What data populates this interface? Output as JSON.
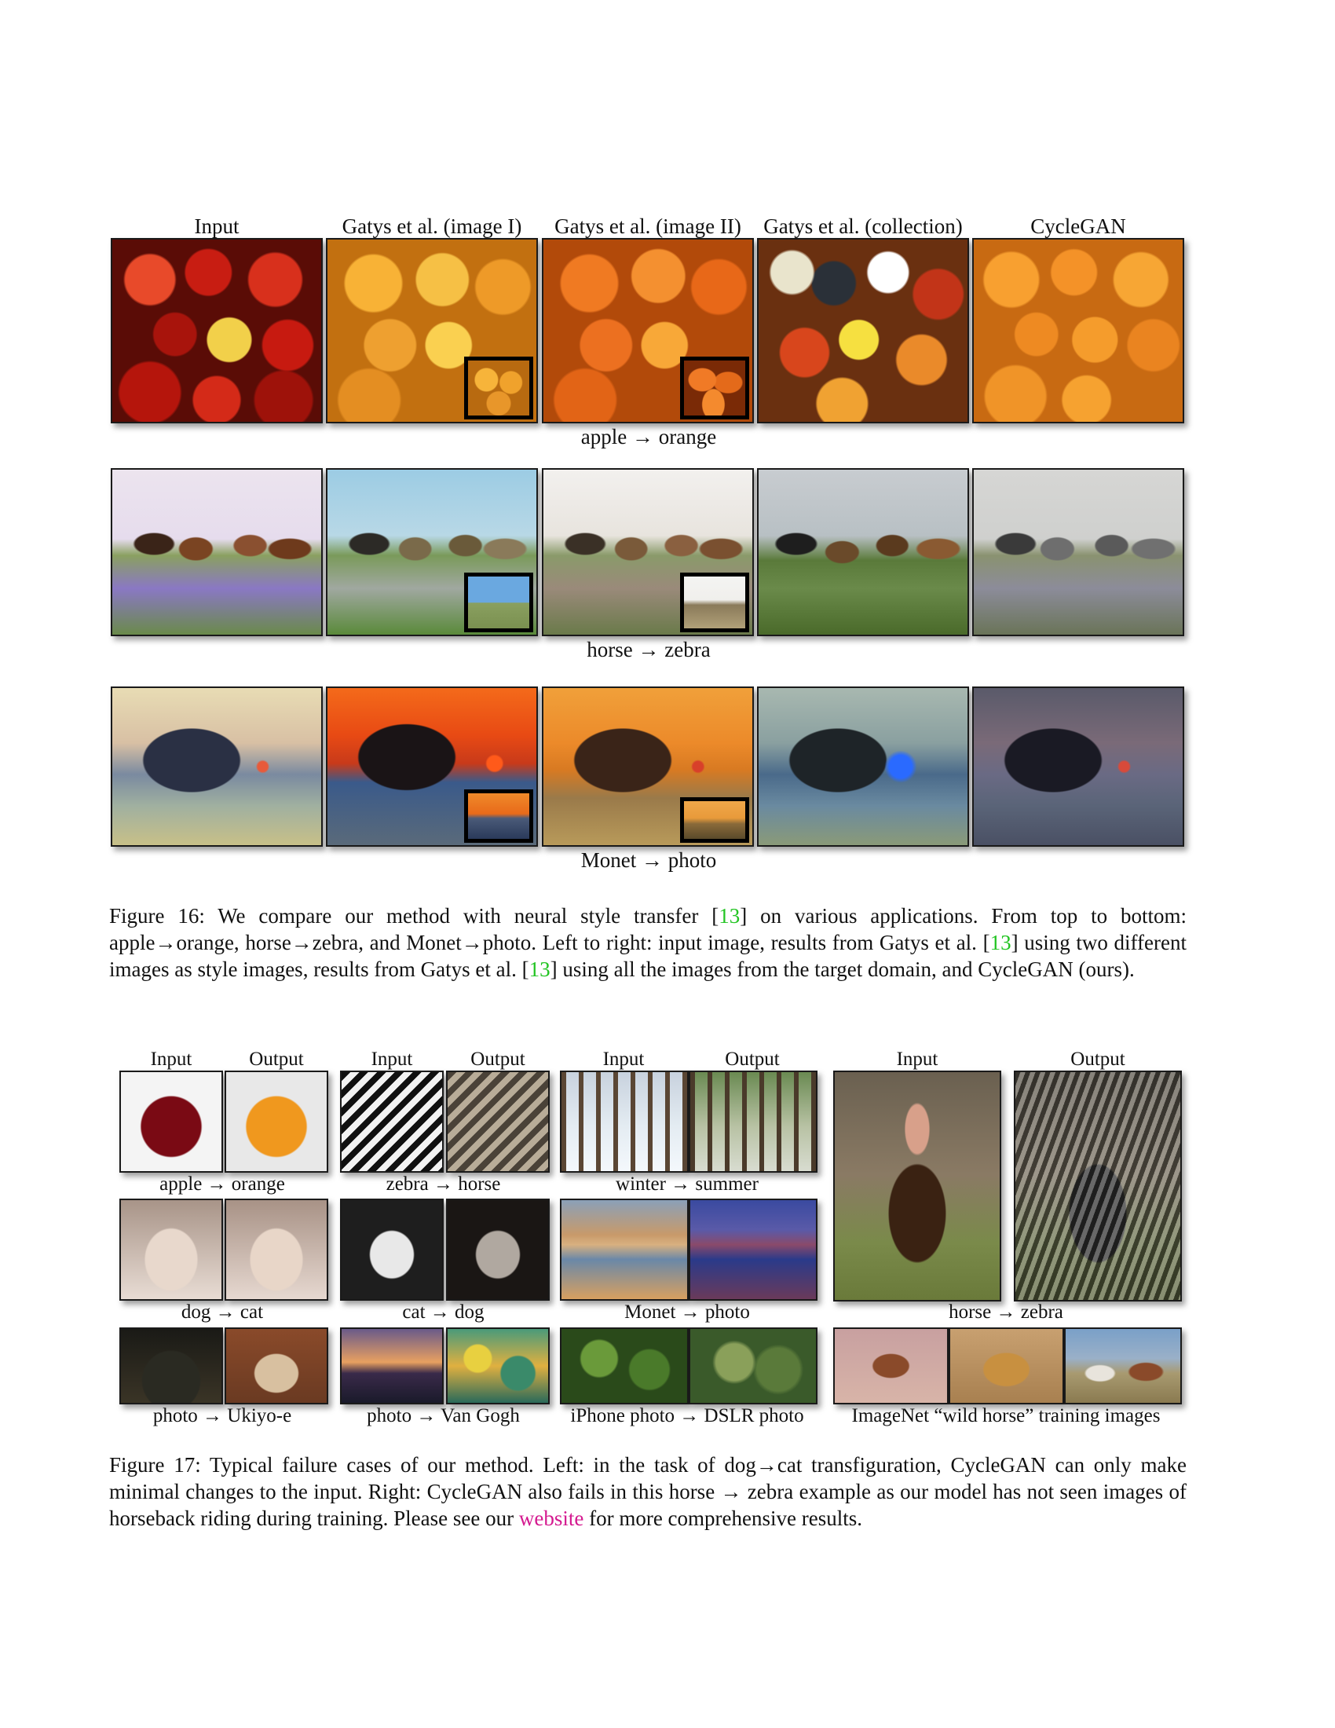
{
  "figure16": {
    "column_headers": [
      "Input",
      "Gatys et al. (image I)",
      "Gatys et al. (image II)",
      "Gatys et al. (collection)",
      "CycleGAN"
    ],
    "row_labels": [
      "apple → orange",
      "horse  → zebra",
      "Monet → photo"
    ],
    "caption": {
      "p1": "Figure 16:  We compare our method with neural style transfer [",
      "ref": "13",
      "p2": "] on various applications.  From top to bottom: apple→orange, horse→zebra, and Monet→photo. Left to right: input image, results from Gatys et al. [",
      "p3": "] using two different images as style images, results from Gatys et al. [",
      "p4": "] using all the images from the target domain, and CycleGAN (ours)."
    }
  },
  "figure17": {
    "headers": {
      "input": "Input",
      "output": "Output"
    },
    "labels": {
      "apple_orange": "apple → orange",
      "zebra_horse": "zebra → horse",
      "winter_summer": "winter → summer",
      "dog_cat": "dog → cat",
      "cat_dog": "cat → dog",
      "monet_photo": "Monet → photo",
      "horse_zebra": "horse → zebra",
      "photo_ukiyoe": "photo → Ukiyo-e",
      "photo_vangogh": "photo → Van Gogh",
      "iphone_dslr": "iPhone photo → DSLR photo",
      "imagenet": "ImageNet “wild horse” training images"
    },
    "caption": {
      "p1": "Figure 17: Typical failure cases of our method.  Left:  in the task of dog→cat transfiguration, CycleGAN can only make minimal changes to the input. Right: CycleGAN also fails in this horse → zebra example as our model has not seen images of horseback riding during training. Please see our ",
      "link": "website",
      "p2": " for more comprehensive results."
    }
  }
}
